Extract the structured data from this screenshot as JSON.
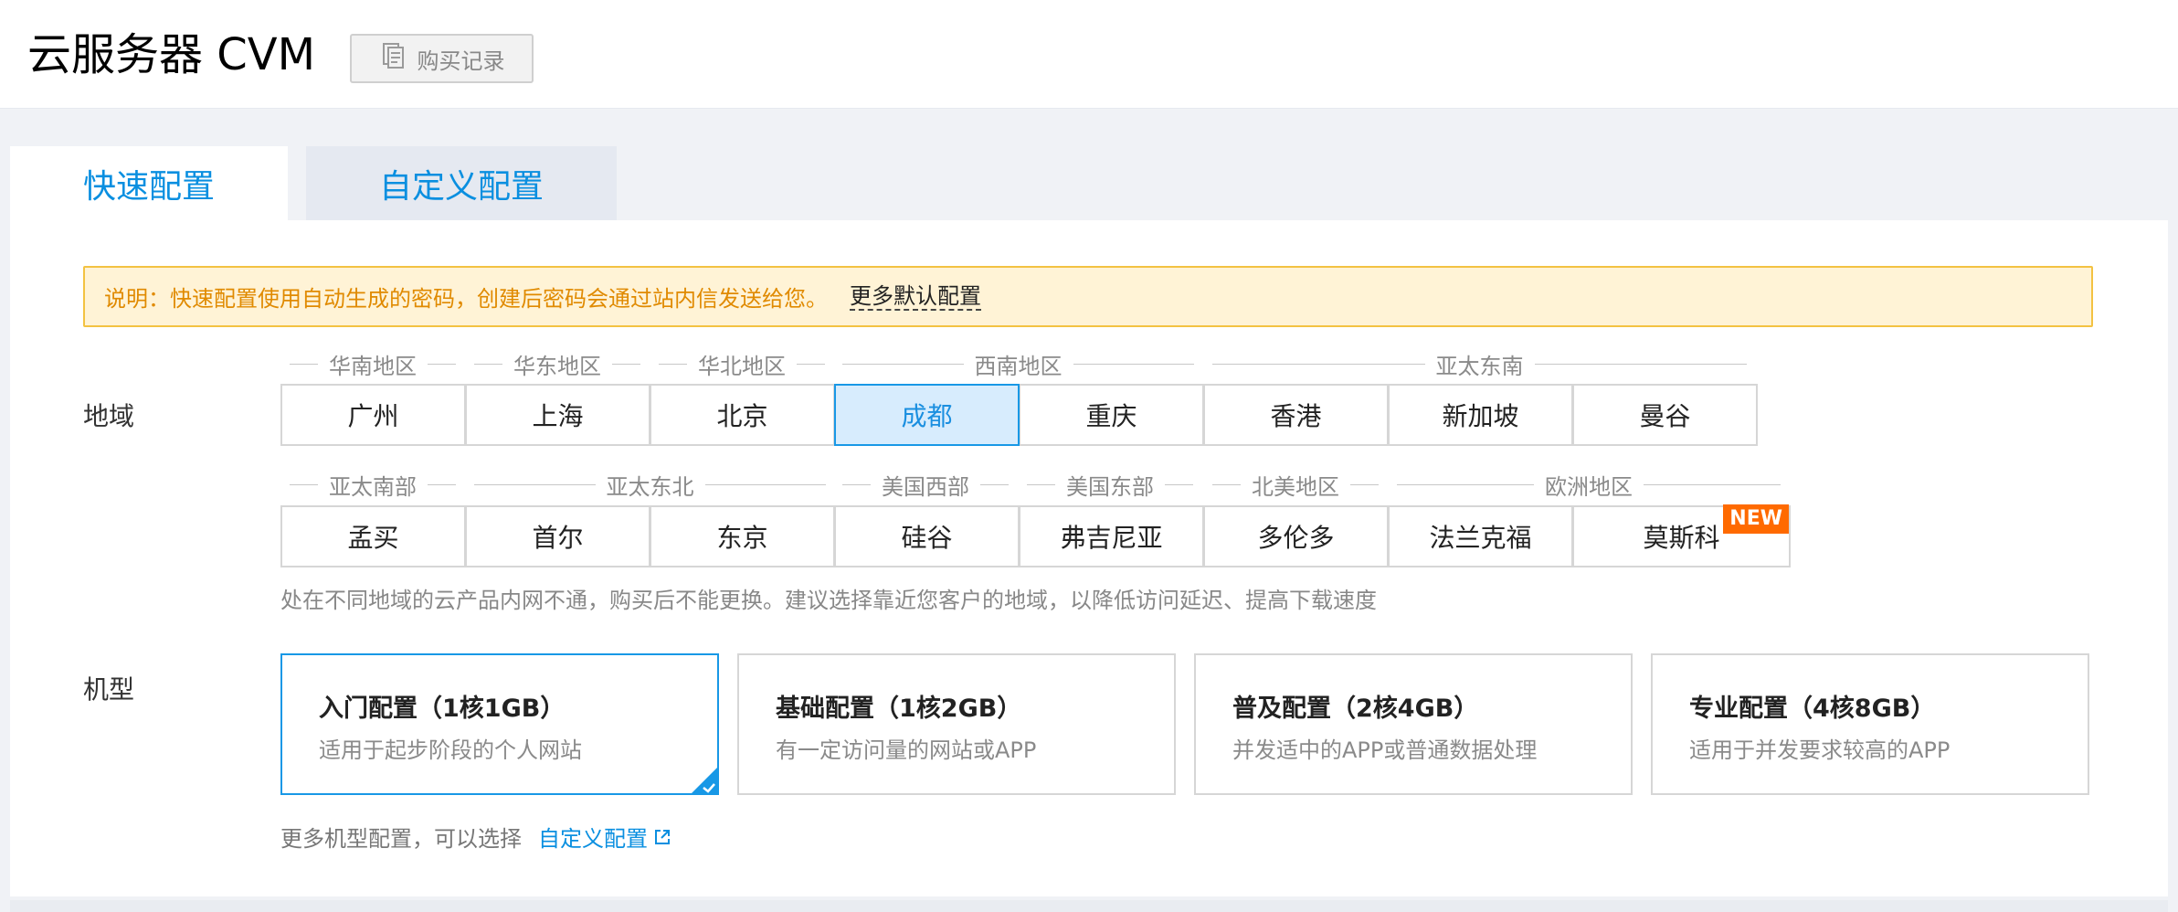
{
  "header": {
    "title": "云服务器 CVM",
    "purchase_button": {
      "label": "购买记录",
      "icon": "receipt-icon"
    }
  },
  "tabs": [
    {
      "label": "快速配置",
      "active": true
    },
    {
      "label": "自定义配置",
      "active": false
    }
  ],
  "notice": {
    "text": "说明：快速配置使用自动生成的密码，创建后密码会通过站内信发送给您。",
    "link": "更多默认配置"
  },
  "region": {
    "label": "地域",
    "row1_groups": [
      "华南地区",
      "华东地区",
      "华北地区",
      "西南地区",
      "亚太东南"
    ],
    "row1": [
      {
        "name": "广州"
      },
      {
        "name": "上海"
      },
      {
        "name": "北京"
      },
      {
        "name": "成都",
        "selected": true
      },
      {
        "name": "重庆"
      },
      {
        "name": "香港"
      },
      {
        "name": "新加坡"
      },
      {
        "name": "曼谷"
      }
    ],
    "row2_groups": [
      "亚太南部",
      "亚太东北",
      "美国西部",
      "美国东部",
      "北美地区",
      "欧洲地区"
    ],
    "row2": [
      {
        "name": "孟买"
      },
      {
        "name": "首尔"
      },
      {
        "name": "东京"
      },
      {
        "name": "硅谷"
      },
      {
        "name": "弗吉尼亚"
      },
      {
        "name": "多伦多"
      },
      {
        "name": "法兰克福"
      },
      {
        "name": "莫斯科",
        "badge": "NEW"
      }
    ],
    "hint": "处在不同地域的云产品内网不通，购买后不能更换。建议选择靠近您客户的地域，以降低访问延迟、提高下载速度"
  },
  "machine": {
    "label": "机型",
    "options": [
      {
        "title": "入门配置（1核1GB）",
        "desc": "适用于起步阶段的个人网站",
        "selected": true
      },
      {
        "title": "基础配置（1核2GB）",
        "desc": "有一定访问量的网站或APP"
      },
      {
        "title": "普及配置（2核4GB）",
        "desc": "并发适中的APP或普通数据处理"
      },
      {
        "title": "专业配置（4核8GB）",
        "desc": "适用于并发要求较高的APP"
      }
    ],
    "more_text": "更多机型配置，可以选择",
    "more_link": "自定义配置"
  },
  "colors": {
    "accent": "#1898e6",
    "link": "#0a8fe0",
    "notice_bg": "#fff3d6",
    "notice_text": "#e08a00",
    "badge": "#ff6a00"
  }
}
